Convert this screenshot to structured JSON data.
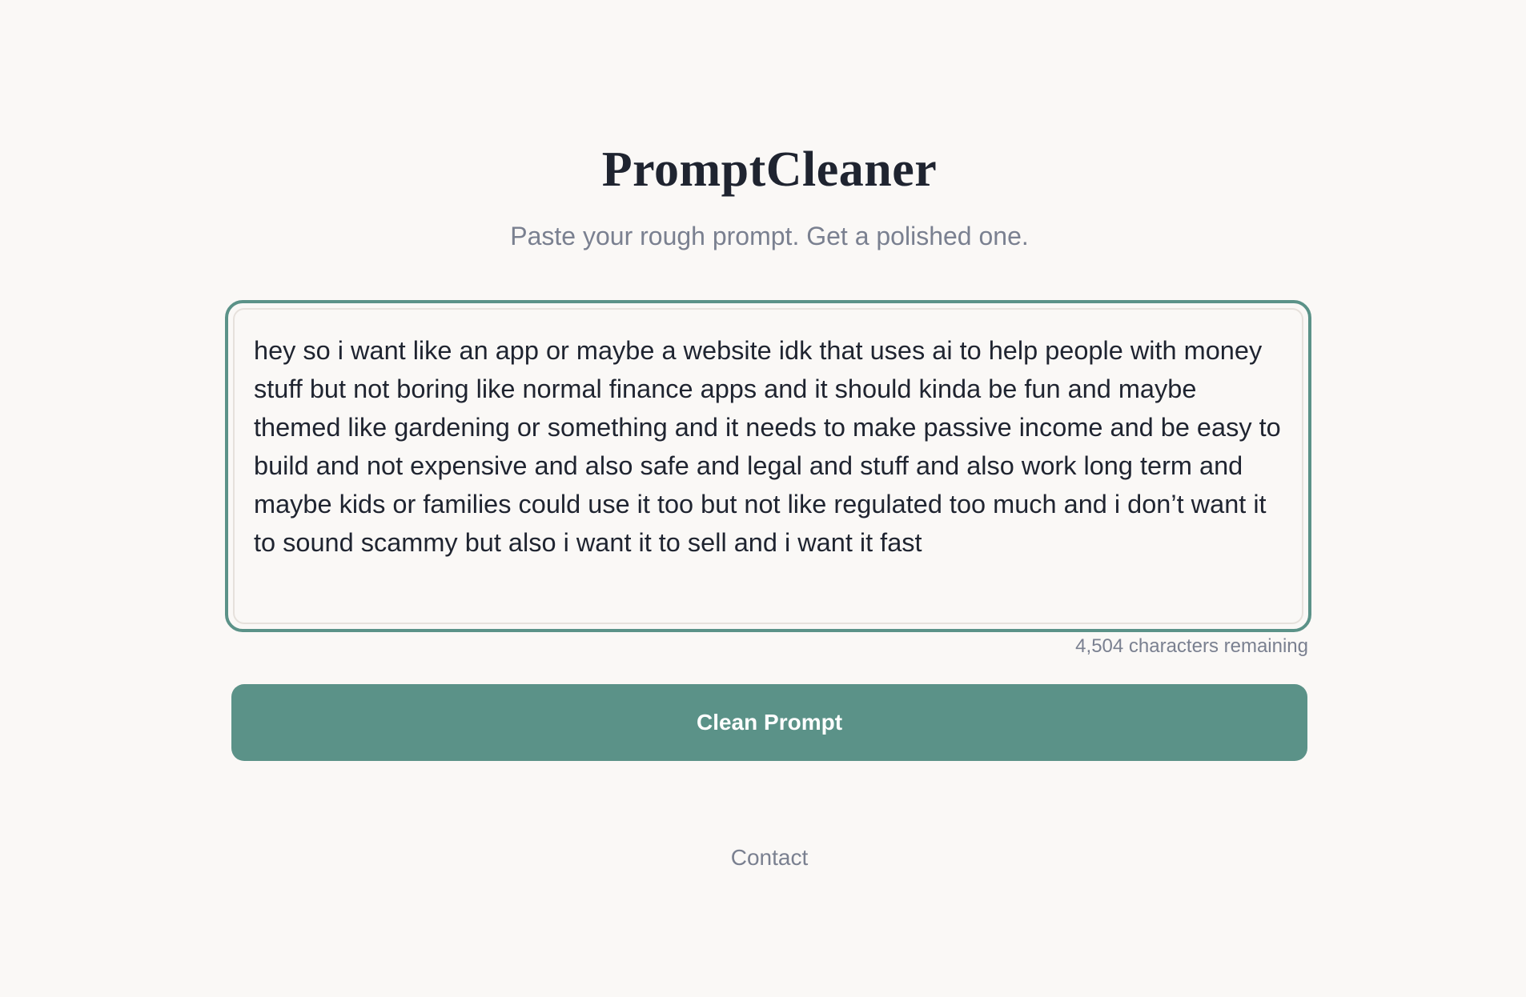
{
  "header": {
    "title": "PromptCleaner",
    "subtitle": "Paste your rough prompt. Get a polished one."
  },
  "prompt_input": {
    "value": "hey so i want like an app or maybe a website idk that uses ai to help people with money stuff but not boring like normal finance apps and it should kinda be fun and maybe themed like gardening or something and it needs to make passive income and be easy to build and not expensive and also safe and legal and stuff and also work long term and maybe kids or families could use it too but not like regulated too much and i don’t want it to sound scammy but also i want it to sell and i want it fast",
    "characters_remaining": "4,504 characters remaining"
  },
  "actions": {
    "clean_label": "Clean Prompt"
  },
  "footer": {
    "contact_label": "Contact"
  },
  "colors": {
    "accent": "#5b9288",
    "background": "#faf8f6",
    "text": "#1f2430",
    "muted": "#7a8090"
  }
}
